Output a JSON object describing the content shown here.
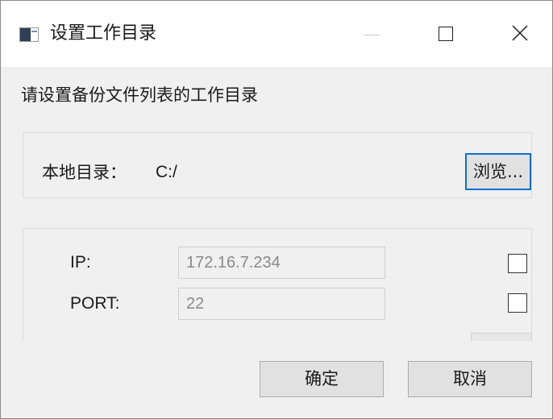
{
  "window": {
    "title": "设置工作目录",
    "icon": "app-window-icon",
    "controls": [
      "minimize-icon",
      "maximize-icon",
      "close-icon"
    ]
  },
  "prompt": "请设置备份文件列表的工作目录",
  "local_dir": {
    "label": "本地目录：",
    "path": "C:/",
    "browse_label": "浏览..."
  },
  "remote": {
    "ip_label": "IP:",
    "ip_value": "172.16.7.234",
    "port_label": "PORT:",
    "port_value": "22",
    "ip_checked": false,
    "port_checked": false
  },
  "buttons": {
    "ok": "确定",
    "cancel": "取消"
  },
  "colors": {
    "focus_border": "#0b6fd0",
    "dialog_bg": "#f0f0f0"
  }
}
